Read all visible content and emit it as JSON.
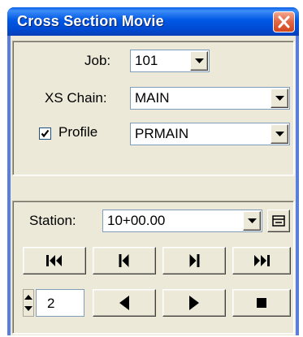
{
  "window": {
    "title": "Cross Section Movie"
  },
  "form": {
    "job_label": "Job:",
    "job_value": "101",
    "xs_chain_label": "XS Chain:",
    "xs_chain_value": "MAIN",
    "profile_label": "Profile",
    "profile_checked": true,
    "profile_value": "PRMAIN"
  },
  "playback": {
    "station_label": "Station:",
    "station_value": "10+00.00",
    "step_value": "2",
    "buttons": {
      "first": "skip-to-first-icon",
      "prev_frame": "step-back-icon",
      "next_frame": "step-forward-icon",
      "last": "skip-to-last-icon",
      "play_reverse": "play-reverse-icon",
      "play": "play-icon",
      "stop": "stop-icon"
    }
  },
  "colors": {
    "title_bar": "#0058e5",
    "close_button": "#e26b48",
    "dialog_face": "#ece9d8"
  }
}
